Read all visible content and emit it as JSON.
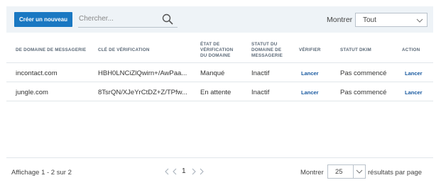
{
  "toolbar": {
    "create_label": "Créer un nouveau",
    "search_placeholder": "Chercher...",
    "show_label": "Montrer",
    "show_value": "Tout"
  },
  "table": {
    "headers": {
      "domain": "DE DOMAINE DE MESSAGERIE",
      "key": "CLÉ DE VÉRIFICATION",
      "verif_state_1": "ÉTAT DE",
      "verif_state_2": "VÉRIFICATION",
      "verif_state_3": "DU DOMAINE",
      "status_1": "STATUT DU",
      "status_2": "DOMAINE DE",
      "status_3": "MESSAGERIE",
      "verify": "VÉRIFIER",
      "dkim": "STATUT DKIM",
      "action": "ACTION"
    },
    "rows": [
      {
        "domain": "incontact.com",
        "key": "HBH0LNCiZlQwirn+/AwPaa...",
        "verif_state": "Manqué",
        "status": "Inactif",
        "verify": "Lancer",
        "dkim": "Pas commencé",
        "action": "Lancer"
      },
      {
        "domain": "jungle.com",
        "key": "8TsrQN/XJeYrCtDZ+Z/TPfw...",
        "verif_state": "En attente",
        "status": "Inactif",
        "verify": "Lancer",
        "dkim": "Pas commencé",
        "action": "Lancer"
      }
    ]
  },
  "footer": {
    "info": "Affichage 1 - 2 sur 2",
    "current_page": "1",
    "show_label": "Montrer",
    "per_page_value": "25",
    "per_page_label": "résultats par page"
  },
  "icons": {
    "search": "search-icon",
    "select_arrow": "chevron-down-icon",
    "pager": [
      "first-page-icon",
      "prev-page-icon",
      "next-page-icon",
      "last-page-icon"
    ]
  }
}
